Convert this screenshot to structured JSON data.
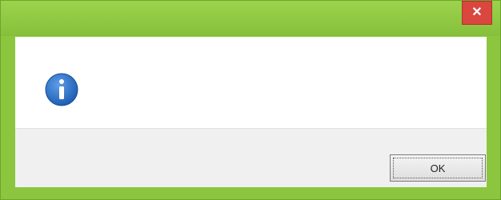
{
  "window": {
    "title": "",
    "close_glyph": "✕"
  },
  "dialog": {
    "icon": "info-icon",
    "message_lines": [
      "",
      ""
    ]
  },
  "buttons": {
    "ok_label": "OK"
  },
  "colors": {
    "frame": "#8cc63e",
    "close": "#d9473f",
    "icon_blue": "#1e5fb4"
  }
}
